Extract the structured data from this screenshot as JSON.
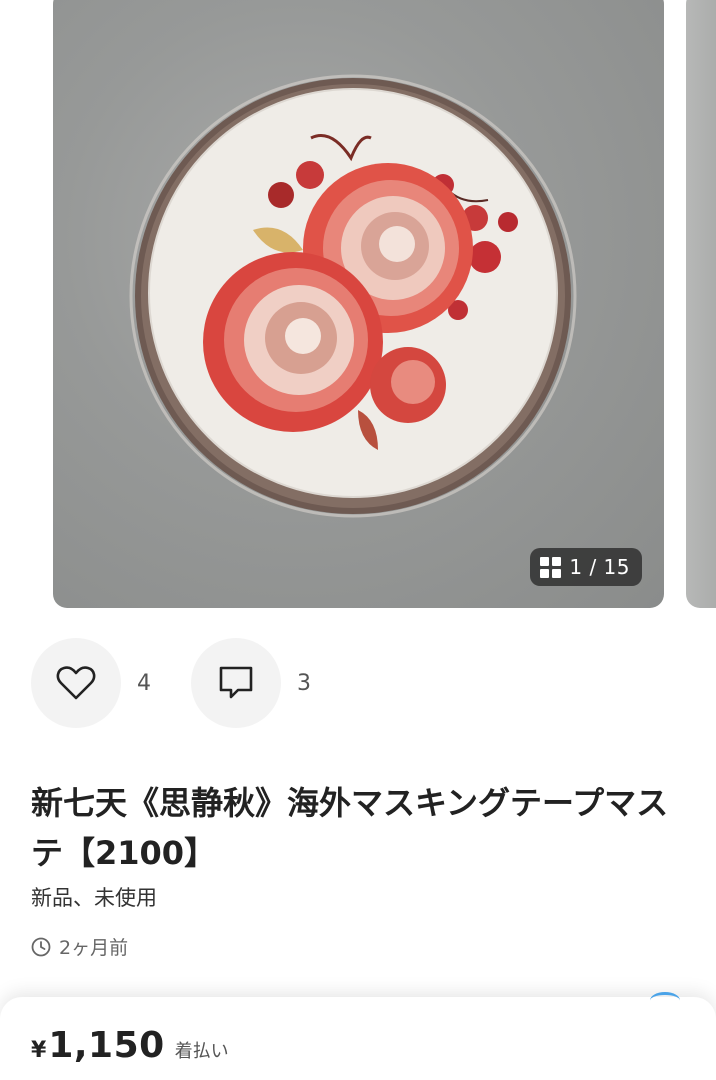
{
  "carousel": {
    "current": "1",
    "total": "15",
    "counter_text": "1 / 15"
  },
  "actions": {
    "likes_count": "4",
    "comments_count": "3"
  },
  "item": {
    "title": "新七天《思静秋》海外マスキングテープマステ【2100】",
    "condition": "新品、未使用",
    "posted": "2ヶ月前"
  },
  "price_bar": {
    "currency": "¥",
    "amount": "1,150",
    "shipping": "着払い"
  },
  "colors": {
    "accent_blue": "#4aa3e8",
    "rose_red": "#d9463f"
  }
}
